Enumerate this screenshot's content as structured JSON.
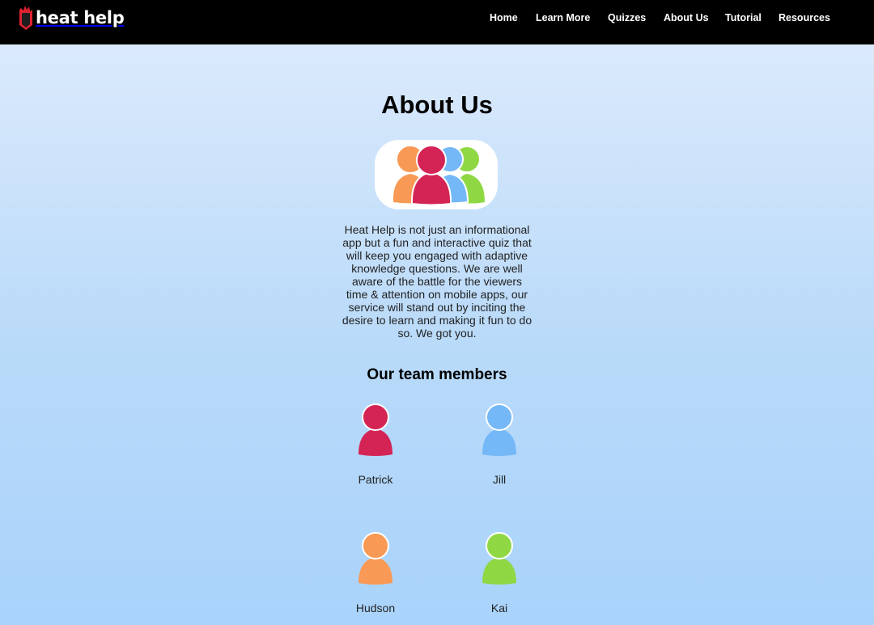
{
  "app": {
    "brand": "heat help",
    "logo_icon": "flame-shield-icon"
  },
  "nav": {
    "items": [
      {
        "label": "Home"
      },
      {
        "label": "Learn More"
      },
      {
        "label": "Quizzes"
      },
      {
        "label": "About Us"
      },
      {
        "label": "Tutorial"
      },
      {
        "label": "Resources"
      }
    ]
  },
  "main": {
    "title": "About Us",
    "hero_icon": "team-group-icon",
    "description": "Heat Help is not just an informational app but a fun and interactive quiz that will keep you engaged with adaptive knowledge questions. We are well aware of the battle for the viewers time & attention on mobile apps, our service will stand out by inciting the desire to learn and making it fun to do so. We got you.",
    "team_heading": "Our team members",
    "team": [
      {
        "name": "Patrick",
        "color": "#d42456",
        "icon": "person-icon"
      },
      {
        "name": "Jill",
        "color": "#74b8f7",
        "icon": "person-icon"
      },
      {
        "name": "Hudson",
        "color": "#f89a55",
        "icon": "person-icon"
      },
      {
        "name": "Kai",
        "color": "#8fd844",
        "icon": "person-icon"
      }
    ]
  },
  "colors": {
    "navbar": "#000000",
    "background_top": "#e0ecfc",
    "background_bottom": "#a9d3fb",
    "logo_red": "#e0212f"
  }
}
